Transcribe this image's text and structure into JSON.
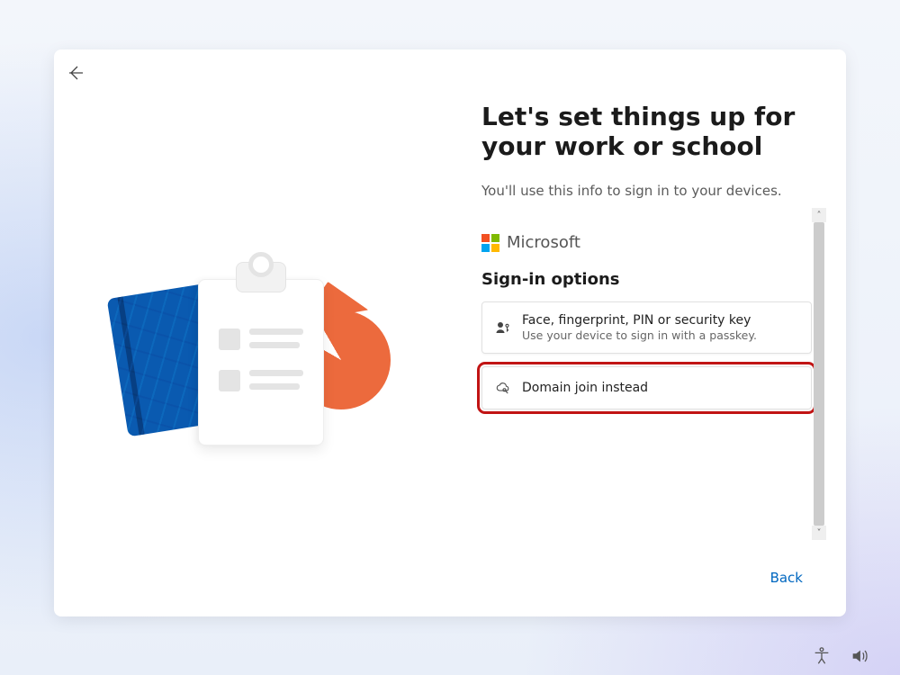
{
  "heading": "Let's set things up for your work or school",
  "subtitle": "You'll use this info to sign in to your devices.",
  "brand_name": "Microsoft",
  "section_title": "Sign-in options",
  "options": [
    {
      "title": "Face, fingerprint, PIN or security key",
      "subtitle": "Use your device to sign in with a passkey."
    },
    {
      "title": "Domain join instead",
      "subtitle": ""
    }
  ],
  "back_label": "Back",
  "highlighted_option_index": 1,
  "colors": {
    "accent": "#0067c0",
    "highlight_outline": "#c11414"
  }
}
